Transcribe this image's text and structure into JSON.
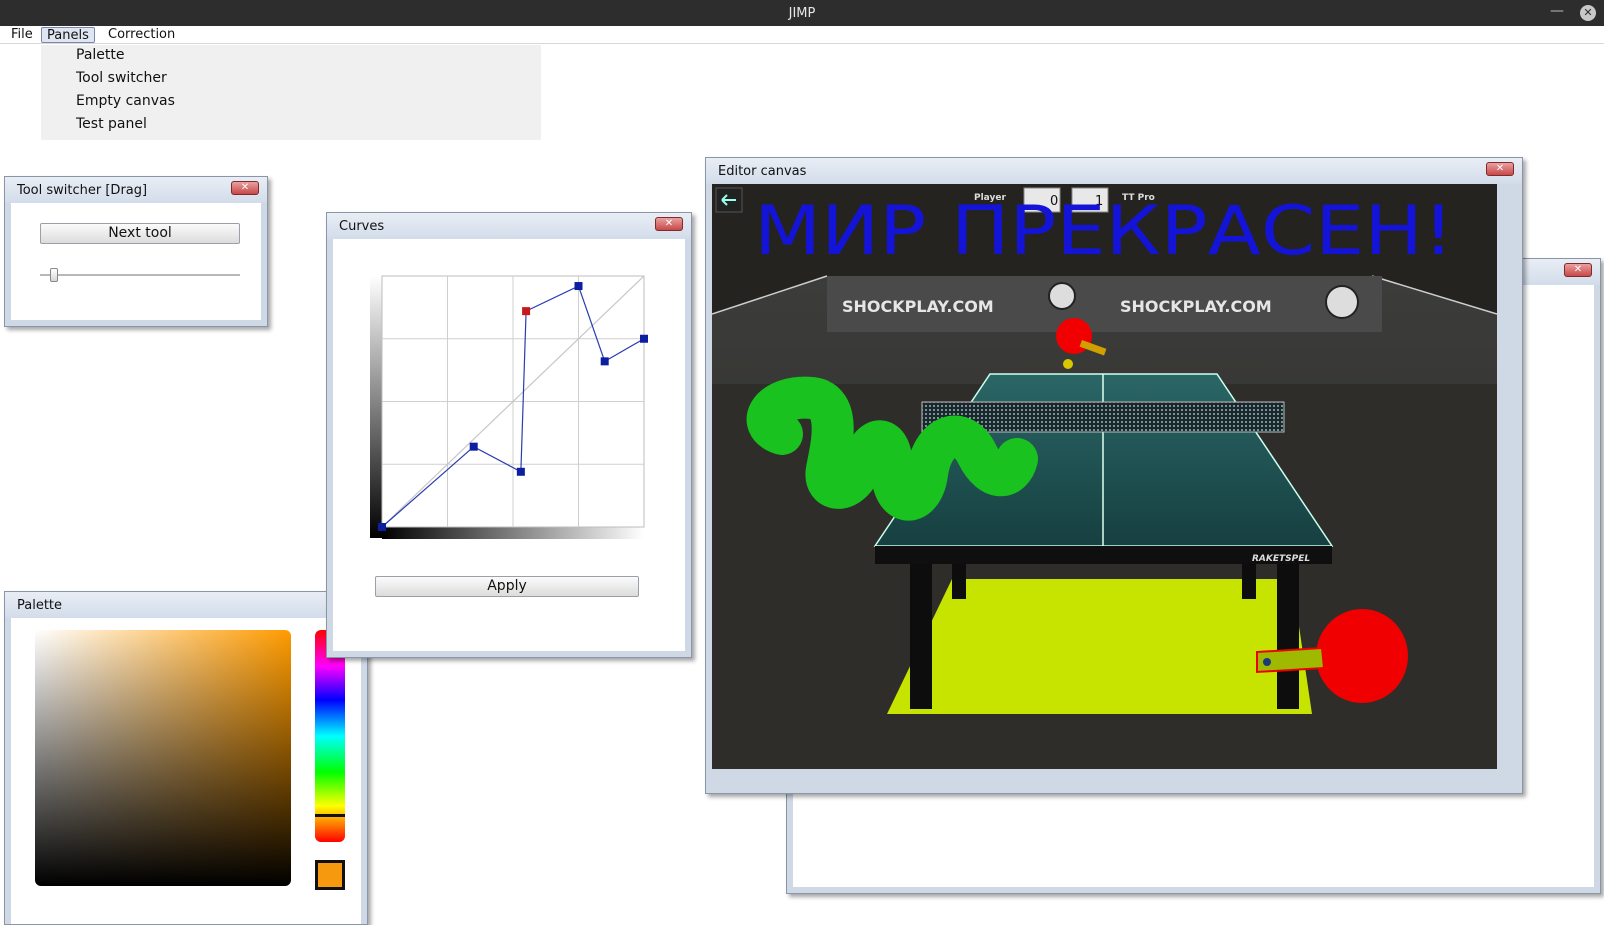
{
  "app": {
    "title": "JIMP"
  },
  "menubar": {
    "items": [
      {
        "label": "File"
      },
      {
        "label": "Panels",
        "active": true
      },
      {
        "label": "Correction"
      }
    ]
  },
  "panels_menu": {
    "items": [
      "Palette",
      "Tool switcher",
      "Empty canvas",
      "Test panel"
    ]
  },
  "tool_switcher": {
    "title": "Tool switcher [Drag]",
    "next_tool_label": "Next tool",
    "slider_value": 0.05
  },
  "curves": {
    "title": "Curves",
    "apply_label": "Apply",
    "points": [
      [
        0,
        0
      ],
      [
        0.35,
        0.32
      ],
      [
        0.53,
        0.22
      ],
      [
        0.55,
        0.86
      ],
      [
        0.75,
        0.96
      ],
      [
        0.85,
        0.66
      ],
      [
        1.0,
        0.75
      ]
    ],
    "selected_point": 3,
    "colors": {
      "curve": "#2b3bb0",
      "point": "#0b1fa0",
      "selected": "#c81818"
    }
  },
  "palette": {
    "title": "Palette",
    "hue_color": "#ff9b00",
    "current_color": "#f7990f"
  },
  "editor_canvas": {
    "title": "Editor canvas",
    "handwriting": "МИР ПРЕКРАСЕН!",
    "banner_text": "SHOCKPLAY.COM",
    "table_brand": "RAKETSPEL",
    "hud": {
      "player_label": "Player",
      "player_score": "0",
      "opponent_score": "1",
      "opponent_label": "TT Pro"
    },
    "colors": {
      "ink": "#1414d8",
      "scribble": "#19c21f",
      "floor": "#c6e400",
      "table": "#1e4f4f",
      "paddle": "#f00000"
    }
  },
  "background_canvas": {
    "has_close": true
  }
}
